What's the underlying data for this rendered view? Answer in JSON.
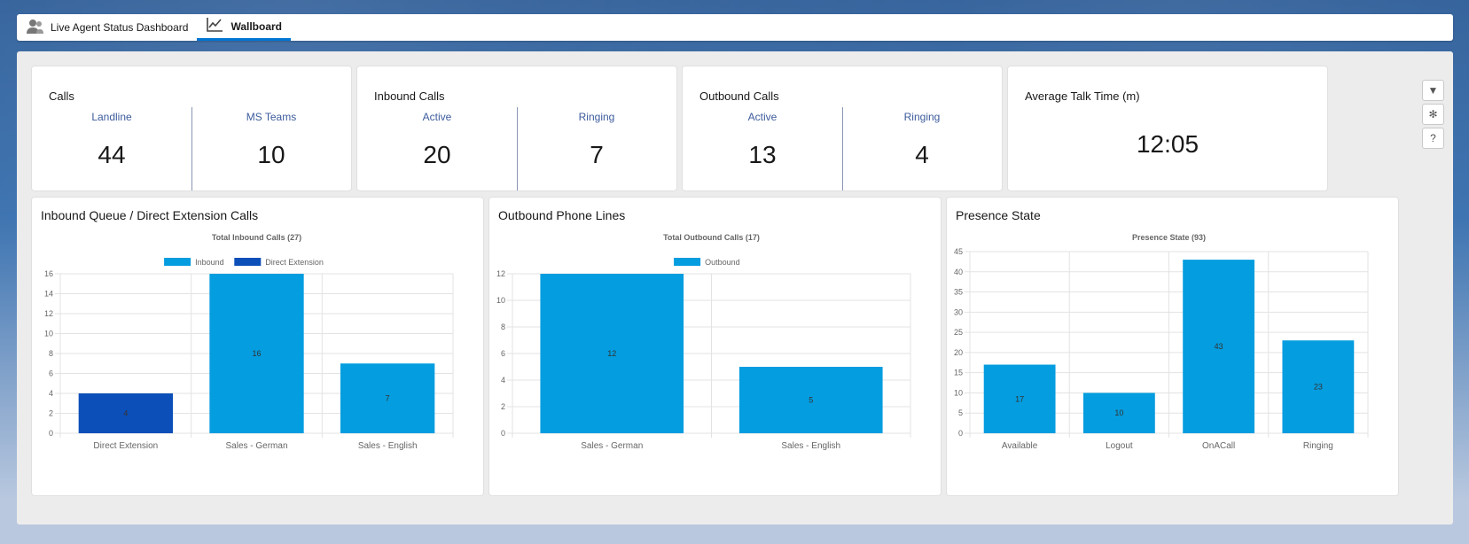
{
  "tabs": [
    {
      "label": "Live Agent Status Dashboard",
      "icon": "agents-icon"
    },
    {
      "label": "Wallboard",
      "icon": "line-chart-icon",
      "active": true
    }
  ],
  "kpis": {
    "calls": {
      "title": "Calls",
      "left_label": "Landline",
      "left_value": "44",
      "right_label": "MS Teams",
      "right_value": "10"
    },
    "inbound": {
      "title": "Inbound Calls",
      "left_label": "Active",
      "left_value": "20",
      "right_label": "Ringing",
      "right_value": "7"
    },
    "outbound": {
      "title": "Outbound Calls",
      "left_label": "Active",
      "left_value": "13",
      "right_label": "Ringing",
      "right_value": "4"
    },
    "talk_time": {
      "title": "Average Talk Time (m)",
      "value": "12:05"
    }
  },
  "side_buttons": [
    {
      "icon": "filter-icon",
      "glyph": "▼"
    },
    {
      "icon": "gear-icon",
      "glyph": "✻"
    },
    {
      "icon": "help-icon",
      "glyph": "?"
    }
  ],
  "panels": {
    "inbound": {
      "title": "Inbound Queue / Direct Extension Calls"
    },
    "outbound": {
      "title": "Outbound Phone Lines"
    },
    "presence": {
      "title": "Presence State"
    }
  },
  "colors": {
    "inbound": "#049ddf",
    "direct_extension": "#0c4fb9",
    "grid": "#e3e3e3"
  },
  "chart_data": [
    {
      "type": "bar",
      "title": "Total Inbound Calls (27)",
      "categories": [
        "Direct Extension",
        "Sales - German",
        "Sales - English"
      ],
      "series": [
        {
          "name": "Inbound",
          "values": [
            0,
            16,
            7
          ]
        },
        {
          "name": "Direct Extension",
          "values": [
            4,
            0,
            0
          ]
        }
      ],
      "ylim": [
        0,
        16
      ],
      "yticks": [
        0,
        2,
        4,
        6,
        8,
        10,
        12,
        14,
        16
      ],
      "legend": "top",
      "grid": true
    },
    {
      "type": "bar",
      "title": "Total Outbound Calls (17)",
      "categories": [
        "Sales - German",
        "Sales - English"
      ],
      "series": [
        {
          "name": "Outbound",
          "values": [
            12,
            5
          ]
        }
      ],
      "ylim": [
        0,
        12
      ],
      "yticks": [
        0,
        2,
        4,
        6,
        8,
        10,
        12
      ],
      "legend": "top",
      "grid": true
    },
    {
      "type": "bar",
      "title": "Presence State (93)",
      "categories": [
        "Available",
        "Logout",
        "OnACall",
        "Ringing"
      ],
      "series": [
        {
          "name": "",
          "values": [
            17,
            10,
            43,
            23
          ]
        }
      ],
      "ylim": [
        0,
        45
      ],
      "yticks": [
        0,
        5,
        10,
        15,
        20,
        25,
        30,
        35,
        40,
        45
      ],
      "legend": "none",
      "grid": true
    }
  ]
}
